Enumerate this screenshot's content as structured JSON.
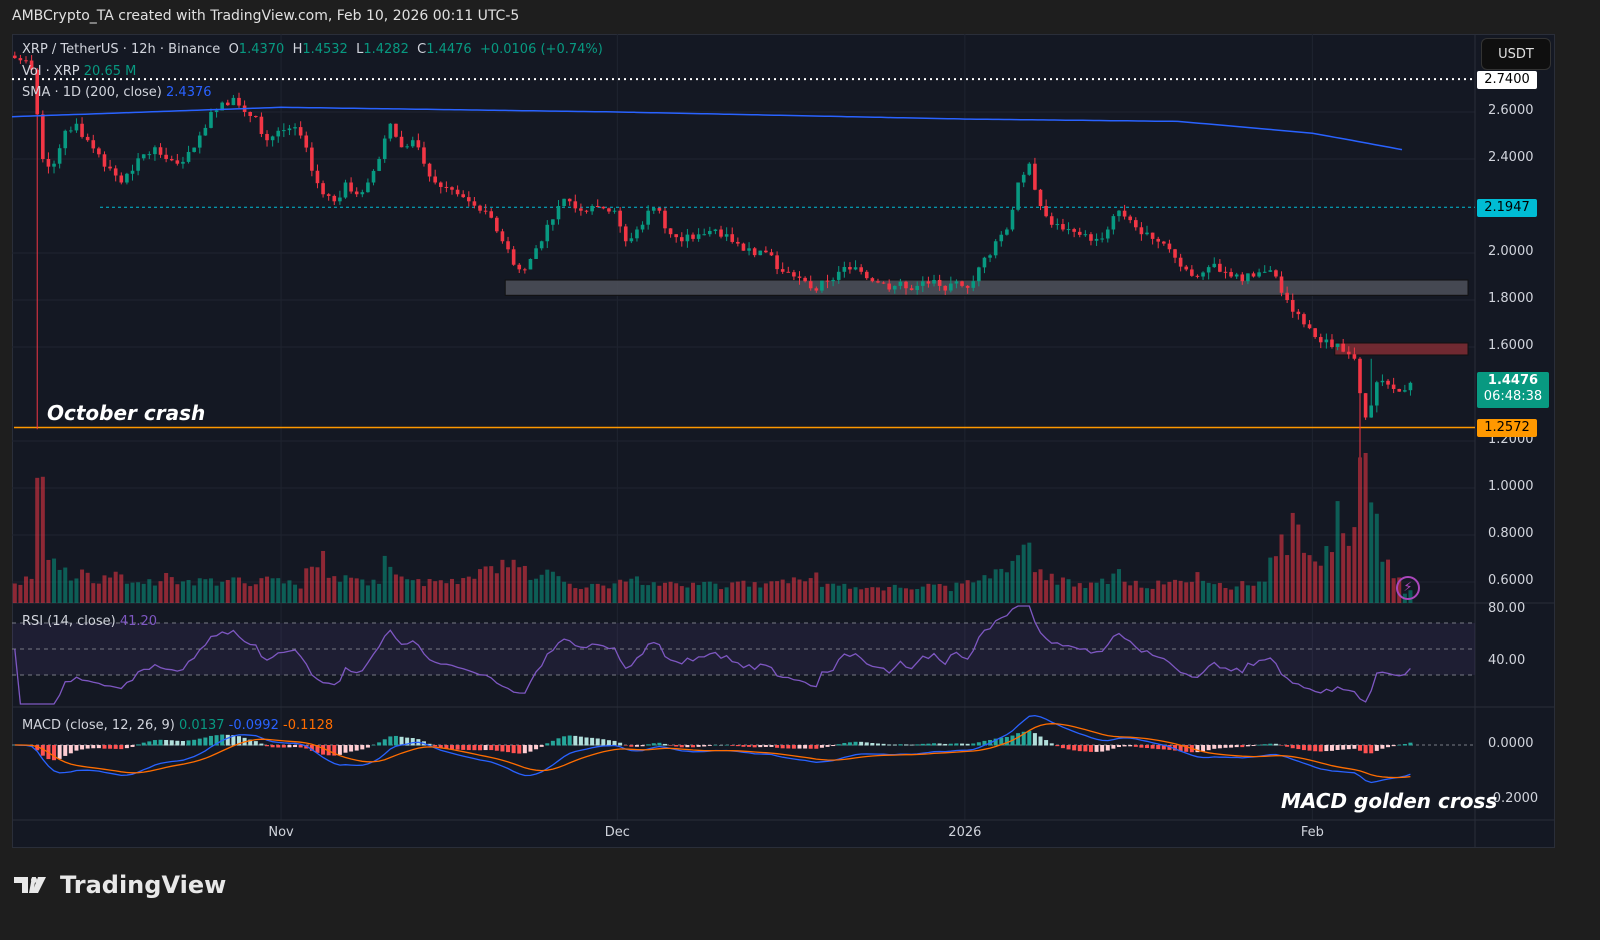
{
  "header": {
    "attribution": "AMBCrypto_TA created with TradingView.com, Feb 10, 2026 00:11 UTC-5"
  },
  "legend": {
    "symbol": "XRP / TetherUS · 12h · Binance",
    "o_label": "O",
    "o": "1.4370",
    "h_label": "H",
    "h": "1.4532",
    "l_label": "L",
    "l": "1.4282",
    "c_label": "C",
    "c": "1.4476",
    "change": "+0.0106 (+0.74%)",
    "vol_label": "Vol · XRP",
    "vol": "20.65 M",
    "sma_label": "SMA · 1D (200, close)",
    "sma": "2.4376",
    "rsi_label": "RSI (14, close)",
    "rsi": "41.20",
    "macd_label": "MACD (close, 12, 26, 9)",
    "macd_hist": "0.0137",
    "macd_line": "-0.0992",
    "macd_signal": "-0.1128"
  },
  "currency_button": "USDT",
  "badges": {
    "top_level": "2.7400",
    "cyan_level": "2.1947",
    "last_price": "1.4476",
    "countdown": "06:48:38",
    "support_level": "1.2572"
  },
  "annotations": {
    "october": "October crash",
    "macd": "MACD golden cross"
  },
  "logo": "TradingView",
  "colors": {
    "up": "#089981",
    "down": "#f23645",
    "sma": "#2962ff",
    "rsi": "#7e57c2",
    "macd": "#2962ff",
    "signal": "#ff6d00",
    "cyan": "#00bcd4",
    "orange": "#ff9800"
  },
  "chart_data": {
    "type": "candlestick",
    "title": "XRP / TetherUS 12h",
    "start_date": "2025-10-08",
    "interval": "12h",
    "price_ticks": [
      "2.6000",
      "2.4000",
      "2.0000",
      "1.8000",
      "1.6000",
      "1.2000",
      "1.0000",
      "0.8000",
      "0.6000"
    ],
    "price_tick_values": [
      2.6,
      2.4,
      2.0,
      1.8,
      1.6,
      1.2,
      1.0,
      0.8,
      0.6
    ],
    "rsi_ticks": [
      "80.00",
      "40.00"
    ],
    "rsi_tick_values": [
      80,
      40
    ],
    "macd_ticks": [
      "0.0000",
      "-0.2000"
    ],
    "macd_tick_values": [
      0,
      -0.2
    ],
    "time_labels": [
      {
        "label": "Nov",
        "day": 24
      },
      {
        "label": "Dec",
        "day": 54
      },
      {
        "label": "2026",
        "day": 85
      },
      {
        "label": "Feb",
        "day": 116
      }
    ],
    "daily_closes": [
      2.82,
      2.78,
      2.4,
      2.38,
      2.52,
      2.55,
      2.48,
      2.42,
      2.36,
      2.3,
      2.35,
      2.42,
      2.45,
      2.4,
      2.38,
      2.43,
      2.5,
      2.6,
      2.64,
      2.66,
      2.6,
      2.58,
      2.48,
      2.52,
      2.53,
      2.5,
      2.35,
      2.25,
      2.22,
      2.3,
      2.25,
      2.3,
      2.4,
      2.55,
      2.45,
      2.48,
      2.38,
      2.3,
      2.28,
      2.25,
      2.22,
      2.18,
      2.15,
      2.05,
      1.95,
      1.93,
      2.02,
      2.12,
      2.2,
      2.22,
      2.18,
      2.2,
      2.19,
      2.18,
      2.05,
      2.1,
      2.18,
      2.18,
      2.08,
      2.05,
      2.06,
      2.08,
      2.1,
      2.08,
      2.04,
      2.02,
      2.01,
      1.99,
      1.92,
      1.9,
      1.88,
      1.84,
      1.88,
      1.92,
      1.93,
      1.92,
      1.88,
      1.87,
      1.86,
      1.85,
      1.86,
      1.87,
      1.86,
      1.87,
      1.86,
      1.88,
      1.98,
      2.05,
      2.1,
      2.3,
      2.38,
      2.2,
      2.12,
      2.1,
      2.09,
      2.08,
      2.06,
      2.1,
      2.18,
      2.14,
      2.08,
      2.06,
      2.04,
      1.98,
      1.93,
      1.9,
      1.94,
      1.92,
      1.9,
      1.88,
      1.9,
      1.92,
      1.9,
      1.8,
      1.74,
      1.68,
      1.62,
      1.6,
      1.58,
      1.55,
      1.3,
      1.45,
      1.44,
      1.41,
      1.4476
    ],
    "wick_extremes": [
      {
        "day": 2,
        "low": 1.25
      },
      {
        "day": 120,
        "low": 1.13
      },
      {
        "day": 121,
        "high": 1.55
      }
    ],
    "daily_volume_relative": [
      15,
      20,
      100,
      35,
      25,
      18,
      20,
      16,
      18,
      22,
      12,
      14,
      15,
      18,
      16,
      14,
      15,
      18,
      14,
      16,
      15,
      14,
      18,
      16,
      14,
      12,
      25,
      30,
      20,
      18,
      15,
      14,
      16,
      28,
      18,
      15,
      14,
      16,
      15,
      14,
      18,
      20,
      22,
      25,
      30,
      24,
      16,
      20,
      18,
      14,
      12,
      13,
      14,
      12,
      15,
      16,
      14,
      13,
      15,
      14,
      12,
      13,
      14,
      12,
      13,
      14,
      12,
      15,
      14,
      16,
      14,
      18,
      12,
      13,
      12,
      11,
      12,
      10,
      11,
      10,
      11,
      12,
      11,
      10,
      12,
      14,
      18,
      20,
      25,
      28,
      35,
      22,
      18,
      15,
      14,
      12,
      13,
      15,
      20,
      14,
      13,
      12,
      14,
      16,
      15,
      18,
      14,
      12,
      11,
      13,
      12,
      14,
      30,
      40,
      55,
      30,
      25,
      35,
      60,
      45,
      100,
      65,
      25,
      15,
      8
    ],
    "sma200_daily_keypoints": [
      {
        "day": 0,
        "value": 2.58
      },
      {
        "day": 24,
        "value": 2.62
      },
      {
        "day": 54,
        "value": 2.6
      },
      {
        "day": 85,
        "value": 2.57
      },
      {
        "day": 104,
        "value": 2.56
      },
      {
        "day": 116,
        "value": 2.51
      },
      {
        "day": 124,
        "value": 2.44
      }
    ],
    "levels": [
      {
        "name": "top",
        "value": 2.74,
        "style": "dotted"
      },
      {
        "name": "resistance",
        "value": 2.1947,
        "style": "dashed"
      },
      {
        "name": "october-low",
        "value": 1.2572,
        "style": "solid"
      }
    ],
    "zones": [
      {
        "name": "support-zone",
        "from_day": 44,
        "low": 1.82,
        "high": 1.885
      },
      {
        "name": "resistance-zone",
        "from_day": 118,
        "low": 1.566,
        "high": 1.617
      }
    ],
    "rsi_bands": [
      70,
      50,
      30
    ]
  }
}
